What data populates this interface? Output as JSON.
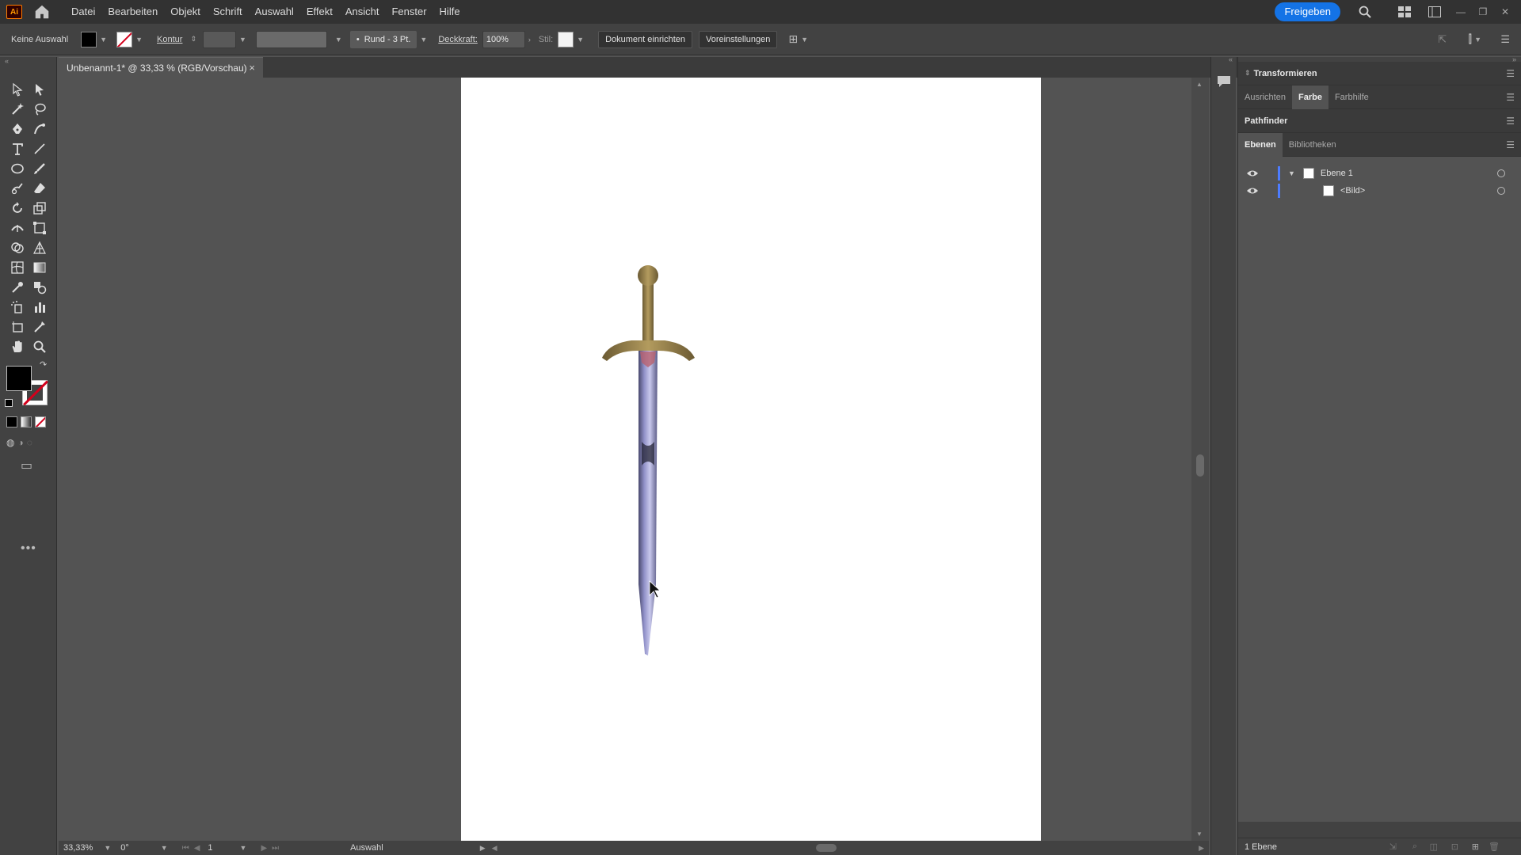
{
  "app": {
    "logo": "Ai"
  },
  "menu": {
    "items": [
      "Datei",
      "Bearbeiten",
      "Objekt",
      "Schrift",
      "Auswahl",
      "Effekt",
      "Ansicht",
      "Fenster",
      "Hilfe"
    ],
    "share_label": "Freigeben"
  },
  "control": {
    "selection": "Keine Auswahl",
    "stroke_label": "Kontur",
    "brush": "Rund - 3 Pt.",
    "opacity_label": "Deckkraft:",
    "opacity_value": "100%",
    "style_label": "Stil:",
    "doc_setup": "Dokument einrichten",
    "prefs": "Voreinstellungen"
  },
  "document": {
    "tab_title": "Unbenannt-1* @ 33,33 % (RGB/Vorschau)",
    "close": "×"
  },
  "status": {
    "zoom": "33,33%",
    "rotation": "0°",
    "artboard": "1",
    "tool": "Auswahl"
  },
  "panels": {
    "transform": "Transformieren",
    "tabs1": [
      "Ausrichten",
      "Farbe",
      "Farbhilfe"
    ],
    "pathfinder": "Pathfinder",
    "tabs2": [
      "Ebenen",
      "Bibliotheken"
    ],
    "layers": [
      {
        "name": "Ebene 1"
      },
      {
        "name": "<Bild>"
      }
    ],
    "footer": "1 Ebene"
  },
  "colors": {
    "accent": "#1473e6",
    "layer_color": "#4d7cfe",
    "stroke_none": "#d4001c"
  },
  "icons": {
    "home": "home-icon",
    "search": "search-icon",
    "eye": "eye-icon",
    "comment": "comment-icon"
  }
}
